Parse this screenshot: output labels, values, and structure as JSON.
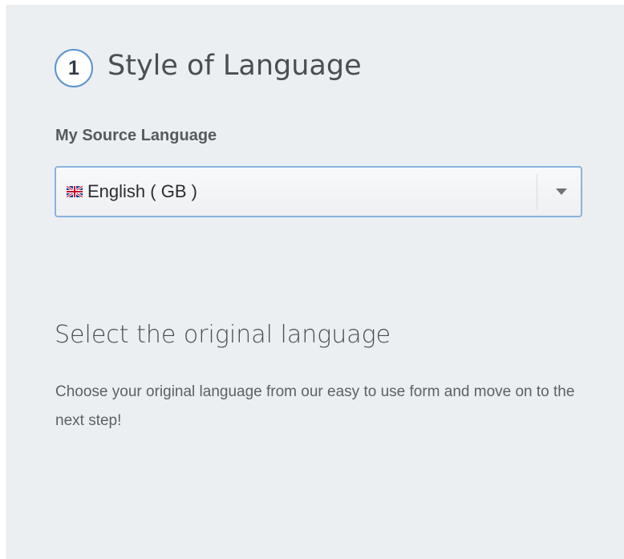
{
  "step": {
    "number": "1",
    "title": "Style of Language"
  },
  "source_language": {
    "label": "My Source Language",
    "selected": {
      "flag_icon": "uk-flag-icon",
      "value": "English ( GB )"
    },
    "dropdown_icon": "chevron-down-icon"
  },
  "info": {
    "heading": "Select the original language",
    "body": "Choose your original language from our easy to use form and move on to the next step!"
  },
  "colors": {
    "panel_background": "#eceff1",
    "accent": "#5b93cf",
    "select_border": "#8bb3df"
  }
}
